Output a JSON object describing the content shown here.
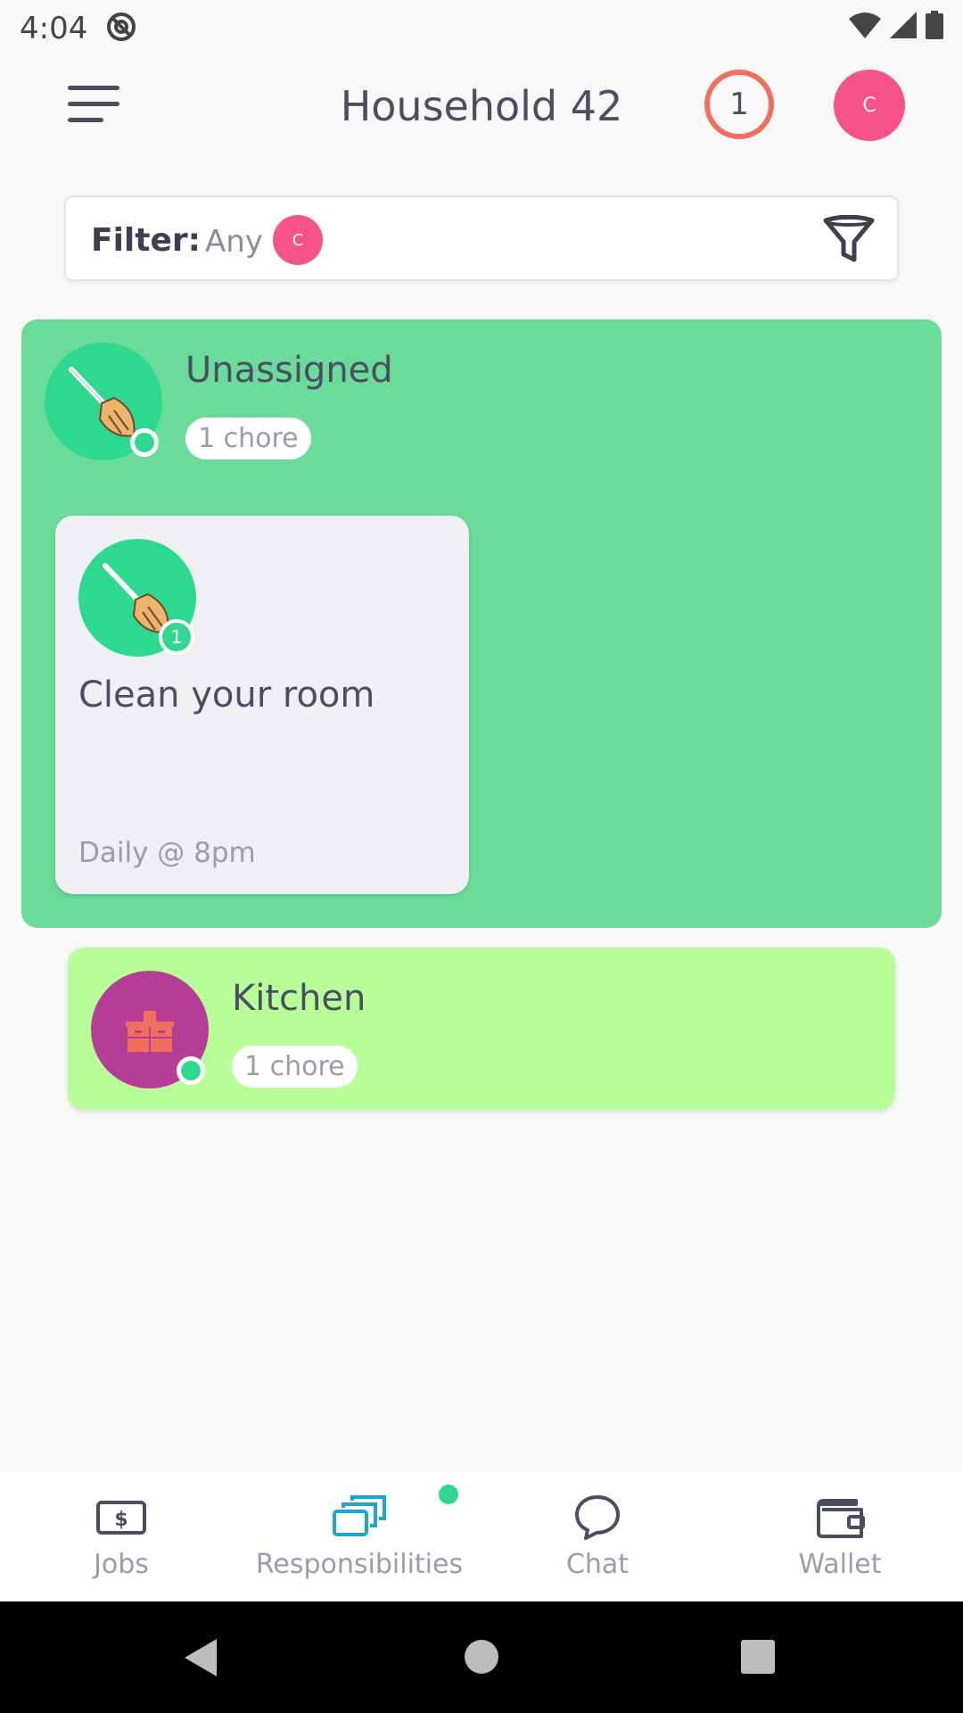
{
  "status_bar": {
    "time": "4:04"
  },
  "header": {
    "title": "Household 42",
    "notification_count": "1",
    "avatar_initial": "C"
  },
  "filter": {
    "label": "Filter:",
    "value": "Any",
    "avatar_initial": "C"
  },
  "groups": [
    {
      "name": "Unassigned",
      "chore_count": "1 chore",
      "icon": "broom-icon",
      "chores": [
        {
          "title": "Clean your room",
          "count": "1",
          "schedule": "Daily @ 8pm",
          "icon": "broom-icon"
        }
      ]
    },
    {
      "name": "Kitchen",
      "chore_count": "1 chore",
      "icon": "kitchen-counter-icon"
    }
  ],
  "bottom_nav": [
    {
      "label": "Jobs",
      "icon": "money-icon"
    },
    {
      "label": "Responsibilities",
      "icon": "cards-icon",
      "active": true
    },
    {
      "label": "Chat",
      "icon": "chat-bubble-icon"
    },
    {
      "label": "Wallet",
      "icon": "wallet-icon"
    }
  ],
  "colors": {
    "unassigned_bg": "#6adb98",
    "kitchen_bg": "#b8fe98",
    "chore_card_bg": "#efeff4",
    "accent_pink": "#f5528a",
    "notification_ring": "#f26e5f",
    "status_green": "#2fd88e",
    "active_nav": "#1fa7c9"
  }
}
